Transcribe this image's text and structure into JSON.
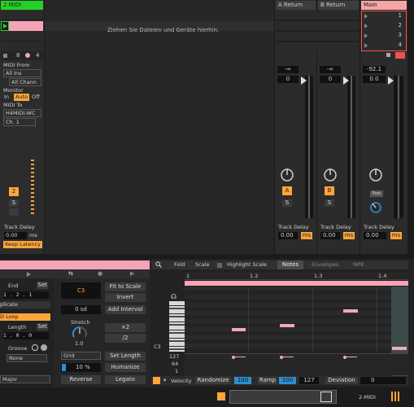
{
  "session": {
    "midi_track_name": "2 MIDI",
    "drop_hint": "Ziehen Sie Dateien und Geräte hierhin.",
    "returns": [
      {
        "name": "A Return",
        "letter": "A"
      },
      {
        "name": "B Return",
        "letter": "B"
      }
    ],
    "main": {
      "name": "Main",
      "scenes": [
        "1",
        "2",
        "3",
        "4"
      ]
    },
    "track_counts": {
      "a": "8",
      "b": "4"
    }
  },
  "io": {
    "midi_from_label": "MIDI From",
    "midi_from_value": "All Ins",
    "channel_value": "All Chann",
    "monitor_label": "Monitor",
    "monitor_in": "In",
    "monitor_auto": "Auto",
    "monitor_off": "Off",
    "midi_to_label": "MIDI To",
    "midi_to_value": "H4MIDI-WC",
    "midi_to_channel": "Ch. 1"
  },
  "mixer": {
    "track_number": "2",
    "solo": "S",
    "volumes": {
      "a": "-∞",
      "b": "-∞",
      "main": "-92.1"
    },
    "zeros": {
      "a": "0",
      "b": "0",
      "main": "0.0"
    },
    "cue_label": "Post",
    "track_delay_label": "Track Delay",
    "track_delay_value": "0.00",
    "ms": "ms",
    "keep_latency": "Keep Latency"
  },
  "clip": {
    "end_label": "End",
    "set_label": "Set",
    "end_value": "1 . 2 . 1",
    "duplicate": "plicate",
    "loop": "D Loop",
    "length_label": "Length",
    "length_value": "1 . 0 . 0",
    "groove_label": "Groove",
    "groove_value": "None",
    "scale_value": "Major"
  },
  "tools": {
    "root_note": "C3",
    "fit_to_scale": "Fit to Scale",
    "invert": "Invert",
    "offset": "0 sd",
    "add_interval": "Add Interval",
    "stretch_label": "Stretch",
    "stretch_value": "1.0",
    "times2": "×2",
    "div2": "/2",
    "grid": "Grid",
    "set_length": "Set Length",
    "percent": "10 %",
    "humanize": "Humanize",
    "reverse": "Reverse",
    "legato": "Legato"
  },
  "editor": {
    "tabs": [
      "Fold",
      "Scale",
      "Highlight Scale",
      "Notes",
      "Envelopes",
      "MPE"
    ],
    "ruler": [
      "1",
      "1.2",
      "1.3",
      "1.4"
    ],
    "note_label": "C3",
    "velocity_ticks": [
      "127",
      "64",
      "1"
    ],
    "velocity_label": "Velocity",
    "randomize": "Randomize",
    "randomize_value": "100",
    "ramp": "Ramp",
    "ramp_from": "100",
    "ramp_to": "127",
    "deviation": "Deviation",
    "deviation_value": "0"
  },
  "statusbar": {
    "track": "2-MIDI"
  },
  "colors": {
    "accent_orange": "#ffa53b",
    "clip_pink": "#f5a3b5",
    "track_green": "#26d126",
    "main_red": "#f0524f",
    "note_pink": "#f3a7b9",
    "blue": "#2f8ecf"
  },
  "icons": [
    "play-icon",
    "stop-icon",
    "record-icon",
    "headphone-icon",
    "search-icon",
    "pencil-icon",
    "knob-icon",
    "pin-icon"
  ]
}
